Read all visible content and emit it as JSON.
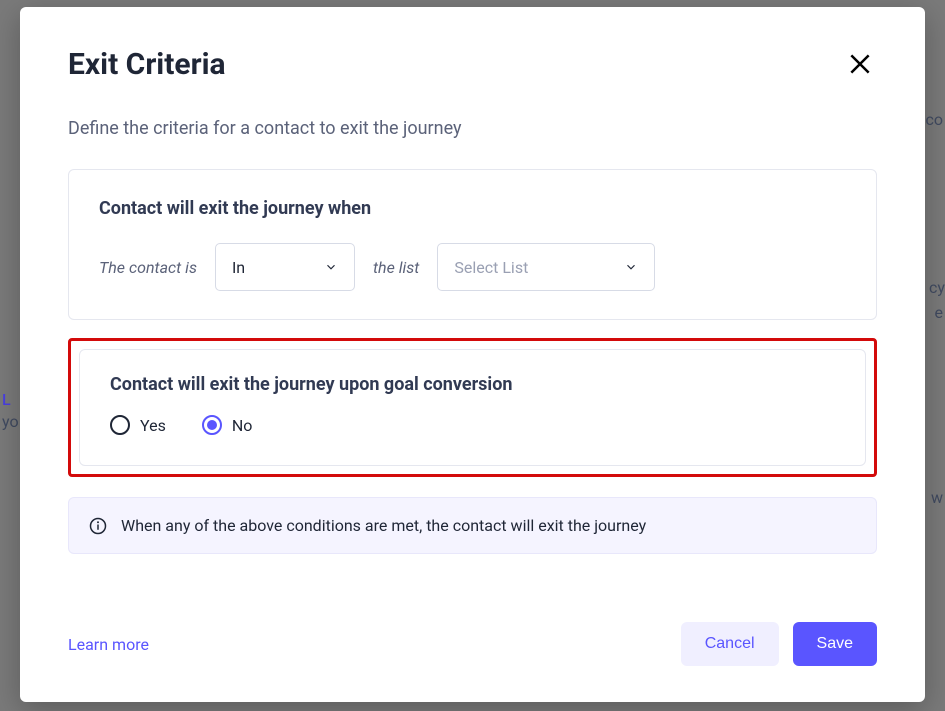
{
  "modal": {
    "title": "Exit Criteria",
    "subtitle": "Define the criteria for a contact to exit the journey"
  },
  "section_when": {
    "heading": "Contact will exit the journey when",
    "prefix_label": "The contact is",
    "in_select_value": "In",
    "middle_label": "the list",
    "list_select_placeholder": "Select List"
  },
  "section_goal": {
    "heading": "Contact will exit the journey upon goal conversion",
    "option_yes": "Yes",
    "option_no": "No",
    "selected": "No"
  },
  "info": {
    "text": "When any of the above conditions are met, the contact will exit the journey"
  },
  "footer": {
    "learn_more": "Learn more",
    "cancel": "Cancel",
    "save": "Save"
  }
}
